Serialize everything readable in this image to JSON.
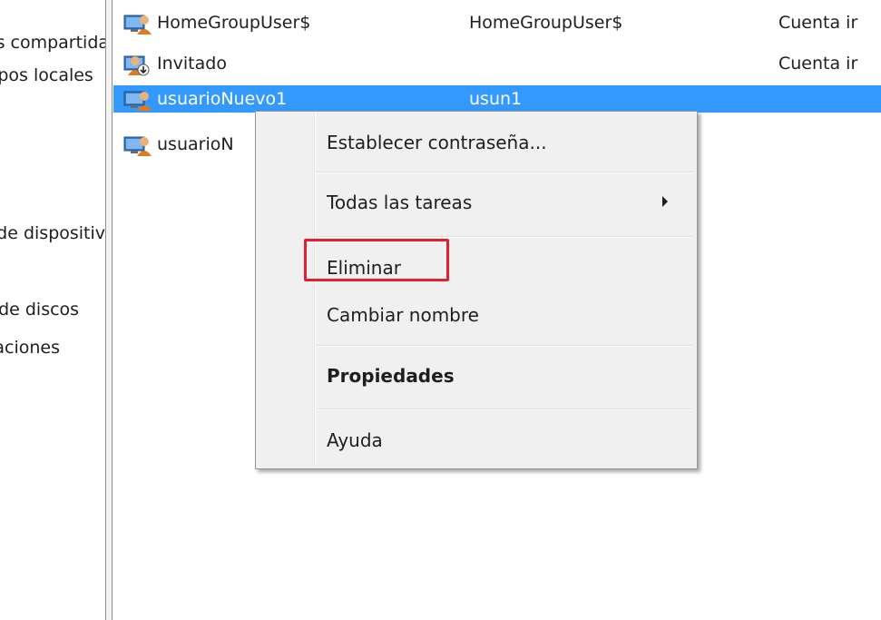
{
  "tree_pane": {
    "items": [
      {
        "label": "Carpetas compartidas"
      },
      {
        "label": "Usuarios y grupos locales"
      },
      {
        "label": "Administrador de dispositivos"
      },
      {
        "label": "Administración de discos"
      },
      {
        "label": "Servicios y aplicaciones"
      }
    ]
  },
  "user_list": {
    "rows": [
      {
        "name": "HomeGroupUser$",
        "full_name": "HomeGroupUser$",
        "description": "Cuenta ir"
      },
      {
        "name": "Invitado",
        "full_name": "",
        "description": "Cuenta ir"
      },
      {
        "name": "usuarioNuevo1",
        "full_name": "usun1",
        "description": ""
      },
      {
        "name": "usuarioN",
        "full_name": "",
        "description": ""
      }
    ]
  },
  "context_menu": {
    "items": [
      {
        "label": "Establecer contraseña..."
      },
      {
        "label": "Todas las tareas"
      },
      {
        "label": "Eliminar"
      },
      {
        "label": "Cambiar nombre"
      },
      {
        "label": "Propiedades"
      },
      {
        "label": "Ayuda"
      }
    ]
  },
  "colors": {
    "selection": "#3399ff",
    "highlight_box": "#e0202c",
    "menu_background": "#f0f0f0"
  }
}
